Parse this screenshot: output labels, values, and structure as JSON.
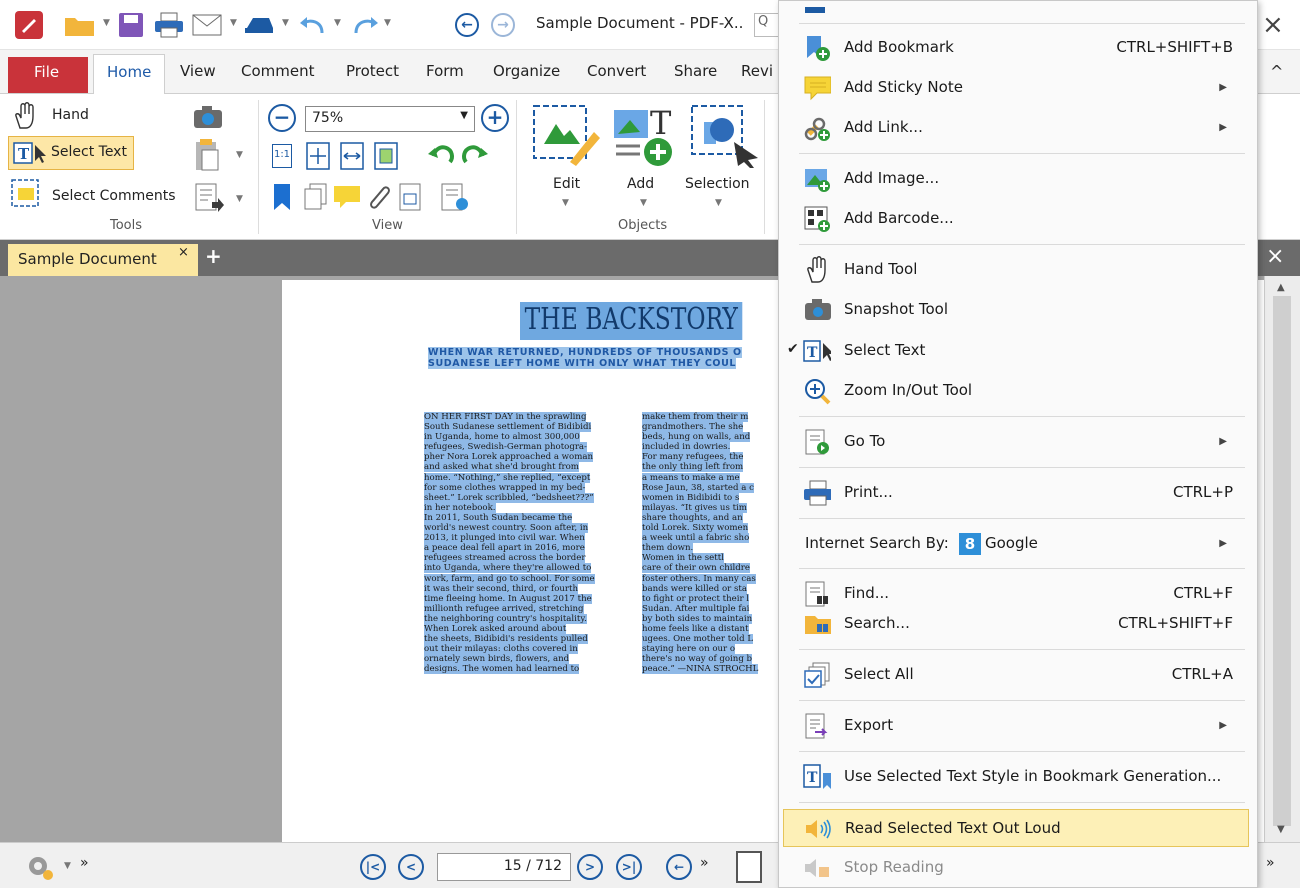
{
  "window": {
    "title": "Sample Document - PDF-X..",
    "search_placeholder": "Q",
    "close": "×"
  },
  "ribbon_tabs": [
    "File",
    "Home",
    "View",
    "Comment",
    "Protect",
    "Form",
    "Organize",
    "Convert",
    "Share",
    "Revi"
  ],
  "ribbon": {
    "tools": {
      "hand": "Hand",
      "select_text": "Select Text",
      "select_comments": "Select Comments",
      "group_label": "Tools"
    },
    "view": {
      "zoom": "75%",
      "group_label": "View",
      "actual_size": "1:1"
    },
    "objects": {
      "edit": "Edit",
      "add": "Add",
      "selection": "Selection",
      "group_label": "Objects"
    }
  },
  "doc_tab": {
    "label": "Sample Document",
    "close": "×",
    "add": "+"
  },
  "page": {
    "title": "THE BACKSTORY",
    "subtitle_lines": [
      "WHEN WAR RETURNED, HUNDREDS OF THOUSANDS O",
      "SUDANESE LEFT HOME WITH ONLY WHAT THEY COUL"
    ],
    "col1": [
      "ON HER FIRST DAY in the sprawling",
      "South Sudanese settlement of Bidibidi",
      "in Uganda, home to almost 300,000",
      "refugees, Swedish-German photogra-",
      "pher Nora Lorek approached a woman",
      "and asked what she'd brought from",
      "home. “Nothing,” she replied, “except",
      "for some clothes wrapped in my bed-",
      "sheet.” Lorek scribbled, “bedsheet???”",
      "in her notebook.",
      "In 2011, South Sudan became the",
      "world's newest country. Soon after, in",
      "2013, it plunged into civil war. When",
      "a peace deal fell apart in 2016, more",
      "refugees streamed across the border",
      "into Uganda, where they're allowed to",
      "work, farm, and go to school. For some",
      "it was their second, third, or fourth",
      "time fleeing home. In August 2017 the",
      "millionth refugee arrived, stretching",
      "the neighboring country's hospitality.",
      "When Lorek asked around about",
      "the sheets, Bidibidi's residents pulled",
      "out their milayas: cloths covered in",
      "ornately sewn birds, flowers, and",
      "designs. The women had learned to"
    ],
    "col2": [
      "make them from their m",
      "grandmothers. The she",
      "beds, hung on walls, and",
      "included in dowries.",
      "For many refugees, the",
      "the only thing left from",
      "a means to make a me",
      "Rose Jaun, 38, started a c",
      "women in Bidibidi to s",
      "milayas. “It gives us tim",
      "share thoughts, and an",
      "told Lorek. Sixty women",
      "a week until a fabric sho",
      "them down.",
      "Women in the settl",
      "care of their own childre",
      "foster others. In many cas",
      "bands were killed or sta",
      "to fight or protect their l",
      "Sudan. After multiple fai",
      "by both sides to maintain",
      "home feels like a distant",
      "ugees. One mother told L",
      "staying here on our o",
      "there's no way of going b",
      "peace.” —NINA STROCHL"
    ]
  },
  "statusbar": {
    "page_display": "15 / 712"
  },
  "context_menu": {
    "items": [
      {
        "label": "Add Bookmark",
        "shortcut": "CTRL+SHIFT+B",
        "icon": "bookmark-add-icon"
      },
      {
        "label": "Add Sticky Note",
        "submenu": true,
        "icon": "sticky-note-icon"
      },
      {
        "label": "Add Link...",
        "submenu": true,
        "icon": "link-add-icon"
      },
      {
        "label": "Add Image...",
        "icon": "image-add-icon"
      },
      {
        "label": "Add Barcode...",
        "icon": "barcode-icon"
      },
      {
        "label": "Hand Tool",
        "icon": "hand-icon"
      },
      {
        "label": "Snapshot Tool",
        "icon": "camera-icon"
      },
      {
        "label": "Select Text",
        "checked": true,
        "icon": "select-text-icon"
      },
      {
        "label": "Zoom In/Out Tool",
        "icon": "zoom-icon"
      },
      {
        "label": "Go To",
        "submenu": true,
        "icon": "go-to-icon"
      },
      {
        "label": "Print...",
        "shortcut": "CTRL+P",
        "icon": "printer-icon"
      },
      {
        "label": "Internet Search By:",
        "engine": "Google",
        "submenu": true
      },
      {
        "label": "Find...",
        "shortcut": "CTRL+F",
        "icon": "find-icon"
      },
      {
        "label": "Search...",
        "shortcut": "CTRL+SHIFT+F",
        "icon": "search-folder-icon"
      },
      {
        "label": "Select All",
        "shortcut": "CTRL+A",
        "icon": "select-all-icon"
      },
      {
        "label": "Export",
        "submenu": true,
        "icon": "export-icon"
      },
      {
        "label": "Use Selected Text Style in Bookmark Generation...",
        "icon": "text-style-bookmark-icon"
      },
      {
        "label": "Read Selected Text Out Loud",
        "highlighted": true,
        "icon": "speaker-icon"
      },
      {
        "label": "Stop Reading",
        "disabled": true,
        "icon": "stop-speaker-icon"
      }
    ]
  },
  "colors": {
    "accent": "#1c5aa3",
    "file_tab": "#c9333a",
    "selection": "#8fb9e7",
    "highlight": "#fdf0b7",
    "doc_tab": "#fbe7a1"
  }
}
